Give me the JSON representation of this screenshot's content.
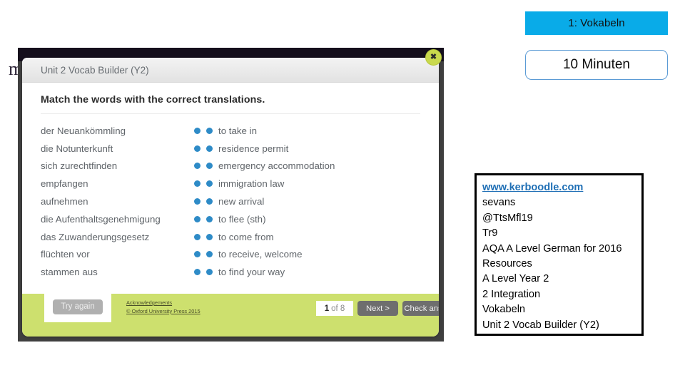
{
  "badges": {
    "slide_title": "1: Vokabeln",
    "timer": "10 Minuten",
    "accent_fill": "#09ABE8",
    "timer_border": "#5B9BD5"
  },
  "background": {
    "partial_letter": "m"
  },
  "info_box": {
    "border_color": "#000000",
    "link": "www.kerboodle.com",
    "link_color": "#1F6FB5",
    "lines": [
      "sevans",
      "@TtsMfl19",
      "Tr9",
      "AQA A Level German for 2016",
      "Resources",
      "A Level Year 2",
      "2 Integration",
      "Vokabeln",
      "Unit 2 Vocab Builder (Y2)"
    ]
  },
  "modal": {
    "title": "Unit 2 Vocab Builder (Y2)",
    "close_glyph": "✖",
    "instruction": "Match the words with the correct translations.",
    "dot_color": "#2E8BC7",
    "toolbar_color": "#CDE06E",
    "german_terms": [
      "der Neuankömmling",
      "die Notunterkunft",
      "sich zurechtfinden",
      "empfangen",
      "aufnehmen",
      "die Aufenthaltsgenehmigung",
      "das Zuwanderungsgesetz",
      "flüchten vor",
      "stammen aus"
    ],
    "english_terms": [
      "to take in",
      "residence permit",
      "emergency accommodation",
      "immigration law",
      "new arrival",
      "to flee (sth)",
      "to come from",
      "to receive, welcome",
      "to find your way"
    ],
    "toolbar": {
      "try_again_label": "Try again",
      "acknowledgements_label": "Acknowledgements",
      "copyright_label": "© Oxford University Press 2015",
      "page_current": "1",
      "page_of": "of 8",
      "next_label": "Next >",
      "check_label": "Check answers"
    }
  }
}
